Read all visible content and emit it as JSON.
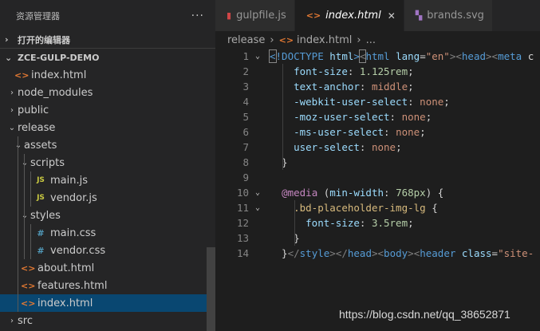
{
  "sidebar": {
    "title": "资源管理器",
    "more": "···",
    "open_editors": "打开的编辑器",
    "project": "ZCE-GULP-DEMO",
    "items": [
      {
        "label": "index.html",
        "icon": "html",
        "depth": 0,
        "twisty": "",
        "selected": false
      },
      {
        "label": "node_modules",
        "icon": "",
        "depth": 0,
        "twisty": "›",
        "selected": false
      },
      {
        "label": "public",
        "icon": "",
        "depth": 0,
        "twisty": "›",
        "selected": false
      },
      {
        "label": "release",
        "icon": "",
        "depth": 0,
        "twisty": "⌄",
        "selected": false
      },
      {
        "label": "assets",
        "icon": "",
        "depth": 1,
        "twisty": "⌄",
        "selected": false
      },
      {
        "label": "scripts",
        "icon": "",
        "depth": 2,
        "twisty": "⌄",
        "selected": false
      },
      {
        "label": "main.js",
        "icon": "js",
        "depth": 3,
        "twisty": "",
        "selected": false
      },
      {
        "label": "vendor.js",
        "icon": "js",
        "depth": 3,
        "twisty": "",
        "selected": false
      },
      {
        "label": "styles",
        "icon": "",
        "depth": 2,
        "twisty": "⌄",
        "selected": false
      },
      {
        "label": "main.css",
        "icon": "css",
        "depth": 3,
        "twisty": "",
        "selected": false
      },
      {
        "label": "vendor.css",
        "icon": "css",
        "depth": 3,
        "twisty": "",
        "selected": false
      },
      {
        "label": "about.html",
        "icon": "html",
        "depth": 1,
        "twisty": "",
        "selected": false
      },
      {
        "label": "features.html",
        "icon": "html",
        "depth": 1,
        "twisty": "",
        "selected": false
      },
      {
        "label": "index.html",
        "icon": "html",
        "depth": 1,
        "twisty": "",
        "selected": true
      },
      {
        "label": "src",
        "icon": "",
        "depth": 0,
        "twisty": "›",
        "selected": false
      }
    ]
  },
  "tabs": [
    {
      "label": "gulpfile.js",
      "icon": "gulp",
      "active": false
    },
    {
      "label": "index.html",
      "icon": "html",
      "active": true,
      "close": "✕"
    },
    {
      "label": "brands.svg",
      "icon": "svg",
      "active": false
    }
  ],
  "breadcrumb": {
    "folder": "release",
    "file": "index.html",
    "more": "..."
  },
  "icons": {
    "html": "<>",
    "js": "JS",
    "css": "#",
    "gulp": "gulp-icon",
    "svg": "svg-icon"
  },
  "colors": {
    "selection": "#094771",
    "editor_bg": "#1e1e1e",
    "sidebar_bg": "#252526"
  },
  "editor": {
    "lines": [
      {
        "n": "1",
        "fold": "⌄",
        "tokens": [
          [
            "tag",
            "<"
          ],
          [
            "tag",
            "!DOCTYPE"
          ],
          [
            "txt",
            " "
          ],
          [
            "attr",
            "html"
          ],
          [
            "tag",
            ">"
          ],
          [
            "punc",
            "<"
          ],
          [
            "tag",
            "html"
          ],
          [
            "txt",
            " "
          ],
          [
            "attr",
            "lang"
          ],
          [
            "txt",
            "="
          ],
          [
            "str",
            "\"en\""
          ],
          [
            "punc",
            ">"
          ],
          [
            "punc",
            "<"
          ],
          [
            "tag",
            "head"
          ],
          [
            "punc",
            ">"
          ],
          [
            "punc",
            "<"
          ],
          [
            "tag",
            "meta"
          ],
          [
            "txt",
            " c"
          ]
        ]
      },
      {
        "n": "2",
        "fold": "",
        "tokens": [
          [
            "txt",
            "    "
          ],
          [
            "prop",
            "font-size"
          ],
          [
            "txt",
            ": "
          ],
          [
            "num",
            "1.125rem"
          ],
          [
            "txt",
            ";"
          ]
        ]
      },
      {
        "n": "3",
        "fold": "",
        "tokens": [
          [
            "txt",
            "    "
          ],
          [
            "prop",
            "text-anchor"
          ],
          [
            "txt",
            ": "
          ],
          [
            "val",
            "middle"
          ],
          [
            "txt",
            ";"
          ]
        ]
      },
      {
        "n": "4",
        "fold": "",
        "tokens": [
          [
            "txt",
            "    "
          ],
          [
            "prop",
            "-webkit-user-select"
          ],
          [
            "txt",
            ": "
          ],
          [
            "val",
            "none"
          ],
          [
            "txt",
            ";"
          ]
        ]
      },
      {
        "n": "5",
        "fold": "",
        "tokens": [
          [
            "txt",
            "    "
          ],
          [
            "prop",
            "-moz-user-select"
          ],
          [
            "txt",
            ": "
          ],
          [
            "val",
            "none"
          ],
          [
            "txt",
            ";"
          ]
        ]
      },
      {
        "n": "6",
        "fold": "",
        "tokens": [
          [
            "txt",
            "    "
          ],
          [
            "prop",
            "-ms-user-select"
          ],
          [
            "txt",
            ": "
          ],
          [
            "val",
            "none"
          ],
          [
            "txt",
            ";"
          ]
        ]
      },
      {
        "n": "7",
        "fold": "",
        "tokens": [
          [
            "txt",
            "    "
          ],
          [
            "prop",
            "user-select"
          ],
          [
            "txt",
            ": "
          ],
          [
            "val",
            "none"
          ],
          [
            "txt",
            ";"
          ]
        ]
      },
      {
        "n": "8",
        "fold": "",
        "tokens": [
          [
            "txt",
            "  }"
          ]
        ]
      },
      {
        "n": "9",
        "fold": "",
        "tokens": []
      },
      {
        "n": "10",
        "fold": "⌄",
        "tokens": [
          [
            "txt",
            "  "
          ],
          [
            "kw",
            "@media"
          ],
          [
            "txt",
            " ("
          ],
          [
            "prop",
            "min-width"
          ],
          [
            "txt",
            ": "
          ],
          [
            "num",
            "768px"
          ],
          [
            "txt",
            ") {"
          ]
        ]
      },
      {
        "n": "11",
        "fold": "⌄",
        "tokens": [
          [
            "txt",
            "    "
          ],
          [
            "sel",
            ".bd-placeholder-img-lg"
          ],
          [
            "txt",
            " {"
          ]
        ]
      },
      {
        "n": "12",
        "fold": "",
        "tokens": [
          [
            "txt",
            "      "
          ],
          [
            "prop",
            "font-size"
          ],
          [
            "txt",
            ": "
          ],
          [
            "num",
            "3.5rem"
          ],
          [
            "txt",
            ";"
          ]
        ]
      },
      {
        "n": "13",
        "fold": "",
        "tokens": [
          [
            "txt",
            "    }"
          ]
        ]
      },
      {
        "n": "14",
        "fold": "",
        "tokens": [
          [
            "txt",
            "  }"
          ],
          [
            "punc",
            "</"
          ],
          [
            "tag",
            "style"
          ],
          [
            "punc",
            ">"
          ],
          [
            "punc",
            "</"
          ],
          [
            "tag",
            "head"
          ],
          [
            "punc",
            ">"
          ],
          [
            "punc",
            "<"
          ],
          [
            "tag",
            "body"
          ],
          [
            "punc",
            ">"
          ],
          [
            "punc",
            "<"
          ],
          [
            "tag",
            "header"
          ],
          [
            "txt",
            " "
          ],
          [
            "attr",
            "class"
          ],
          [
            "txt",
            "="
          ],
          [
            "str",
            "\"site-"
          ]
        ]
      }
    ]
  },
  "watermark": "https://blog.csdn.net/qq_38652871"
}
